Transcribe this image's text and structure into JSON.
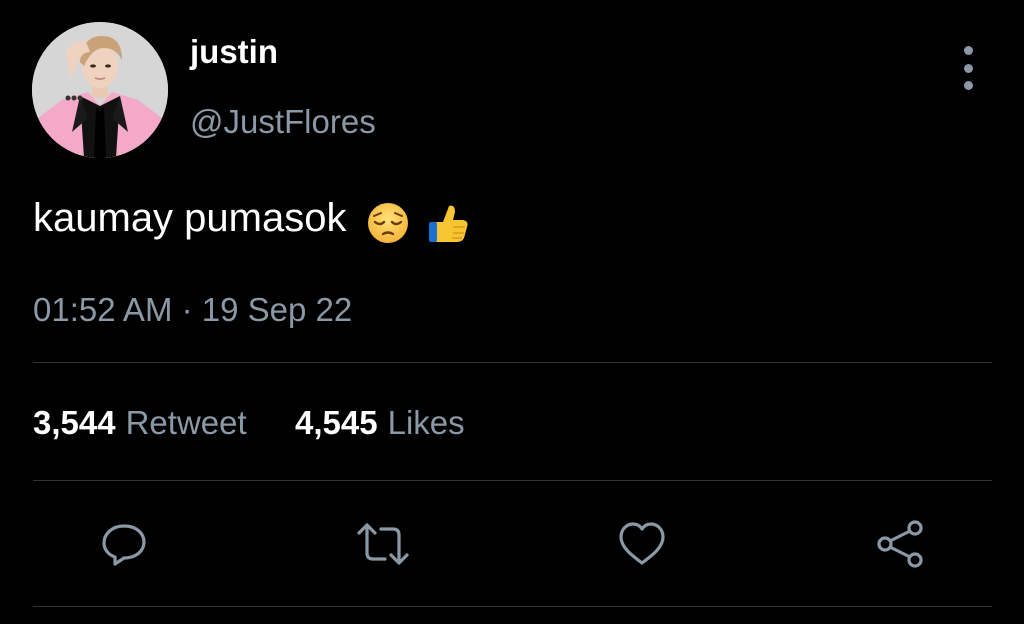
{
  "user": {
    "display_name": "justin",
    "handle": "@JustFlores",
    "avatar_icon": "profile-photo"
  },
  "tweet": {
    "text": "kaumay pumasok",
    "emojis": [
      "pensive-face-emoji",
      "thumbs-up-emoji"
    ],
    "timestamp": "01:52 AM · 19 Sep 22"
  },
  "stats": {
    "retweets_count": "3,544",
    "retweets_label": "Retweet",
    "likes_count": "4,545",
    "likes_label": "Likes"
  },
  "actions": [
    {
      "name": "reply",
      "icon": "speech-bubble-icon"
    },
    {
      "name": "retweet",
      "icon": "retweet-arrows-icon"
    },
    {
      "name": "like",
      "icon": "heart-icon"
    },
    {
      "name": "share",
      "icon": "share-nodes-icon"
    }
  ],
  "colors": {
    "background": "#000000",
    "primary_text": "#ffffff",
    "secondary_text": "#8b98a5",
    "divider": "#2f3336",
    "avatar_jacket": "#f4a9c8"
  }
}
